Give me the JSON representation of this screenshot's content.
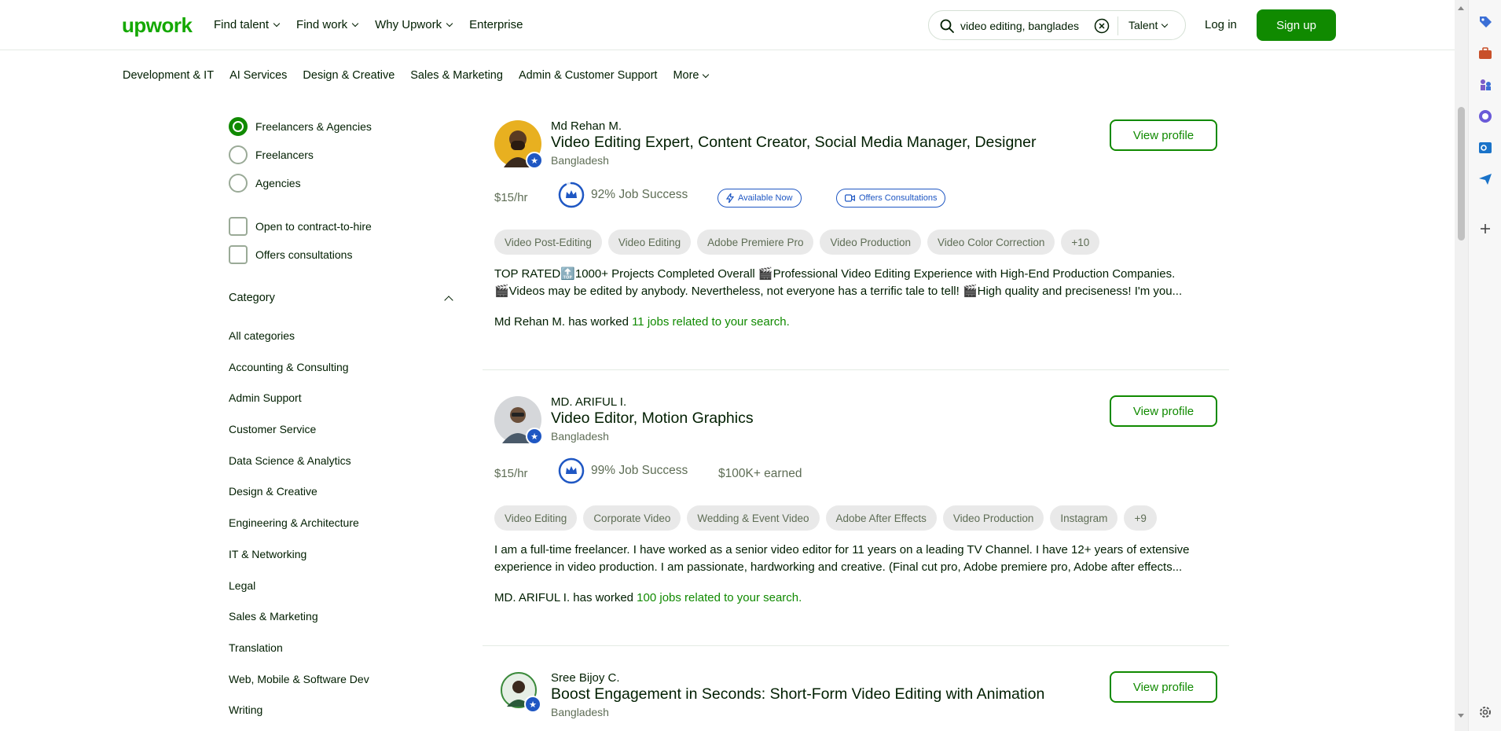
{
  "header": {
    "logo": "upwork",
    "nav": [
      {
        "label": "Find talent",
        "dropdown": true
      },
      {
        "label": "Find work",
        "dropdown": true
      },
      {
        "label": "Why Upwork",
        "dropdown": true
      },
      {
        "label": "Enterprise",
        "dropdown": false
      }
    ],
    "search_value": "video editing, banglades",
    "search_type": "Talent",
    "login": "Log in",
    "signup": "Sign up"
  },
  "category_nav": [
    "Development & IT",
    "AI Services",
    "Design & Creative",
    "Sales & Marketing",
    "Admin & Customer Support",
    "More"
  ],
  "filters": {
    "radios": [
      {
        "label": "Freelancers & Agencies",
        "selected": true
      },
      {
        "label": "Freelancers",
        "selected": false
      },
      {
        "label": "Agencies",
        "selected": false
      }
    ],
    "checkboxes": [
      {
        "label": "Open to contract-to-hire",
        "checked": false
      },
      {
        "label": "Offers consultations",
        "checked": false
      }
    ],
    "category_heading": "Category",
    "categories": [
      "All categories",
      "Accounting & Consulting",
      "Admin Support",
      "Customer Service",
      "Data Science & Analytics",
      "Design & Creative",
      "Engineering & Architecture",
      "IT & Networking",
      "Legal",
      "Sales & Marketing",
      "Translation",
      "Web, Mobile & Software Dev",
      "Writing"
    ]
  },
  "freelancers": [
    {
      "name": "Md Rehan M.",
      "title": "Video Editing Expert, Content Creator, Social Media Manager, Designer",
      "country": "Bangladesh",
      "rate": "$15/hr",
      "job_success": "92% Job Success",
      "job_success_value": 0.92,
      "badges": [
        "Available Now",
        "Offers Consultations"
      ],
      "skills": [
        "Video Post-Editing",
        "Video Editing",
        "Adobe Premiere Pro",
        "Video Production",
        "Video Color Correction",
        "+10"
      ],
      "desc_lines": [
        "TOP RATED🔝1000+ Projects Completed Overall 🎬Professional Video Editing Experience with High-End Production Companies.",
        "🎬Videos may be edited by anybody. Nevertheless, not everyone has a terrific tale to tell! 🎬High quality and preciseness! I'm you..."
      ],
      "worked_prefix": "Md Rehan M. has worked ",
      "worked_link": "11 jobs related to your search.",
      "view": "View profile",
      "avatar_color": "#c98a2b"
    },
    {
      "name": "MD. ARIFUL I.",
      "title": "Video Editor, Motion Graphics",
      "country": "Bangladesh",
      "rate": "$15/hr",
      "job_success": "99% Job Success",
      "job_success_value": 0.99,
      "earned": "$100K+ earned",
      "skills": [
        "Video Editing",
        "Corporate Video",
        "Wedding & Event Video",
        "Adobe After Effects",
        "Video Production",
        "Instagram",
        "+9"
      ],
      "desc_lines": [
        "I am a full-time freelancer. I have worked as a senior video editor for 11 years on a leading TV Channel. I have 12+ years of extensive",
        "experience in video production. I am passionate, hardworking and creative. (Final cut pro, Adobe premiere pro, Adobe after effects..."
      ],
      "worked_prefix": "MD. ARIFUL I. has worked ",
      "worked_link": "100 jobs related to your search.",
      "view": "View profile",
      "avatar_color": "#8a8f95"
    },
    {
      "name": "Sree Bijoy C.",
      "title": "Boost Engagement in Seconds: Short-Form Video Editing with Animation",
      "country": "Bangladesh",
      "view": "View profile",
      "avatar_color": "#3b7a3b"
    }
  ],
  "colors": {
    "brand": "#108a00",
    "logo": "#14a800",
    "badge_blue": "#1f57c3"
  }
}
